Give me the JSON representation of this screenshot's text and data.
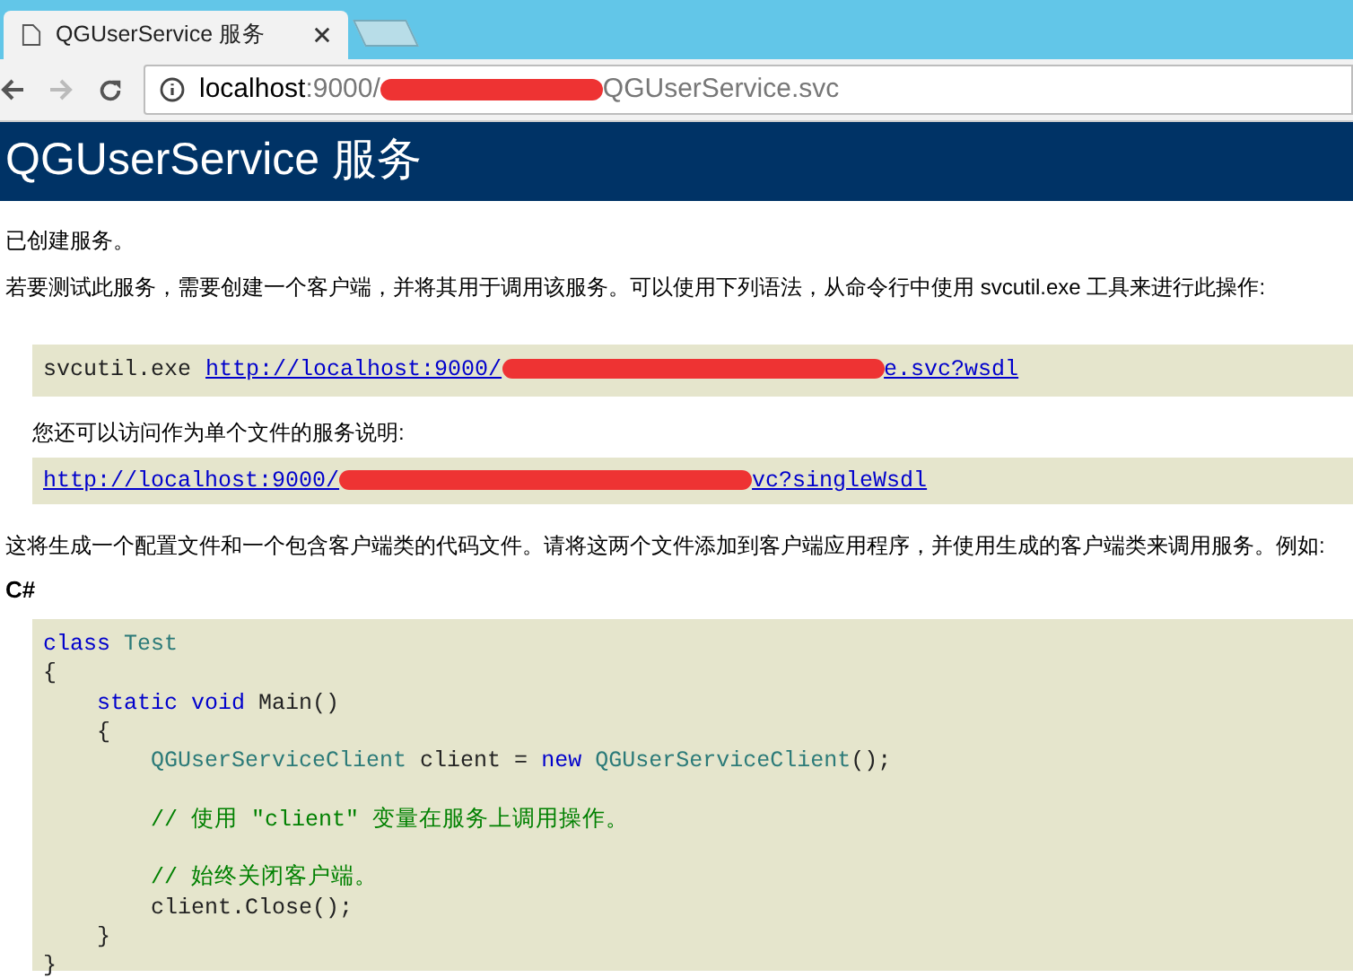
{
  "browser": {
    "tabs": [
      {
        "title": "QGUserService 服务",
        "selected": true
      },
      {
        "kind": "new_tab",
        "selected": false
      }
    ],
    "address": {
      "host": "localhost",
      "rest_before": ":9000/",
      "rest_after": "QGUserService.svc"
    }
  },
  "header": {
    "title": "QGUserService 服务"
  },
  "intro": "已创建服务。",
  "instructions": "若要测试此服务，需要创建一个客户端，并将其用于调用该服务。可以使用下列语法，从命令行中使用 svcutil.exe 工具来进行此操作:",
  "command": {
    "tool": "svcutil.exe",
    "link_start": "http://localhost:9000/",
    "link_end": "e.svc?wsdl"
  },
  "single_file_note": "您还可以访问作为单个文件的服务说明:",
  "single_wsdl": {
    "link_start": "http://localhost:9000/",
    "link_end": "vc?singleWsdl"
  },
  "explanation": "这将生成一个配置文件和一个包含客户端类的代码文件。请将这两个文件添加到客户端应用程序，并使用生成的客户端类来调用服务。例如:",
  "language": "C#",
  "code_lines": [
    [
      {
        "kind": "keyword",
        "text": "class "
      },
      {
        "kind": "type",
        "text": "Test"
      }
    ],
    [
      {
        "kind": "plain",
        "text": "{"
      }
    ],
    [
      {
        "kind": "keyword",
        "text": "    static void"
      },
      {
        "kind": "plain",
        "text": " Main()"
      }
    ],
    [
      {
        "kind": "plain",
        "text": "    {"
      }
    ],
    [
      {
        "kind": "type",
        "text": "        QGUserServiceClient"
      },
      {
        "kind": "plain",
        "text": " client = "
      },
      {
        "kind": "keyword",
        "text": "new "
      },
      {
        "kind": "type",
        "text": "QGUserServiceClient"
      },
      {
        "kind": "plain",
        "text": "();"
      }
    ],
    [
      {
        "kind": "blank"
      }
    ],
    [
      {
        "kind": "comment",
        "text": "        // 使用 \"client\" 变量在服务上调用操作。"
      }
    ],
    [
      {
        "kind": "blank"
      }
    ],
    [
      {
        "kind": "comment",
        "text": "        // 始终关闭客户端。"
      }
    ],
    [
      {
        "kind": "plain",
        "text": "        client.Close();"
      }
    ],
    [
      {
        "kind": "plain",
        "text": "    }"
      }
    ],
    [
      {
        "kind": "plain",
        "text": "}"
      }
    ]
  ]
}
